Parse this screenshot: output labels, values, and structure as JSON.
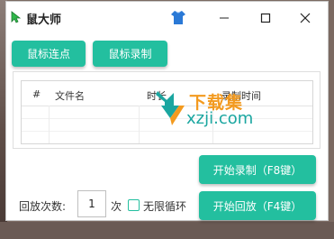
{
  "window": {
    "title": "鼠大师",
    "icon": "green-cursor-icon",
    "skin_icon": "blue-shirt-icon",
    "controls": [
      "minimize-icon",
      "maximize-icon",
      "close-icon"
    ]
  },
  "toolbar": {
    "click_button": "鼠标连点",
    "record_button": "鼠标录制"
  },
  "table": {
    "columns": [
      "#",
      "文件名",
      "时长",
      "录制时间"
    ],
    "rows": []
  },
  "watermark": {
    "cn_text": "下载集",
    "url_text": "xzji.com"
  },
  "actions": {
    "start_record": "开始录制（F8键）",
    "start_playback": "开始回放（F4键）"
  },
  "playback": {
    "count_label": "回放次数:",
    "count_value": "1",
    "count_unit": "次",
    "infinite_loop_label": "无限循环",
    "infinite_loop_checked": false
  },
  "colors": {
    "accent": "#23bf9f",
    "watermark_orange": "#f39a1f",
    "watermark_teal": "#1aa6a0"
  }
}
